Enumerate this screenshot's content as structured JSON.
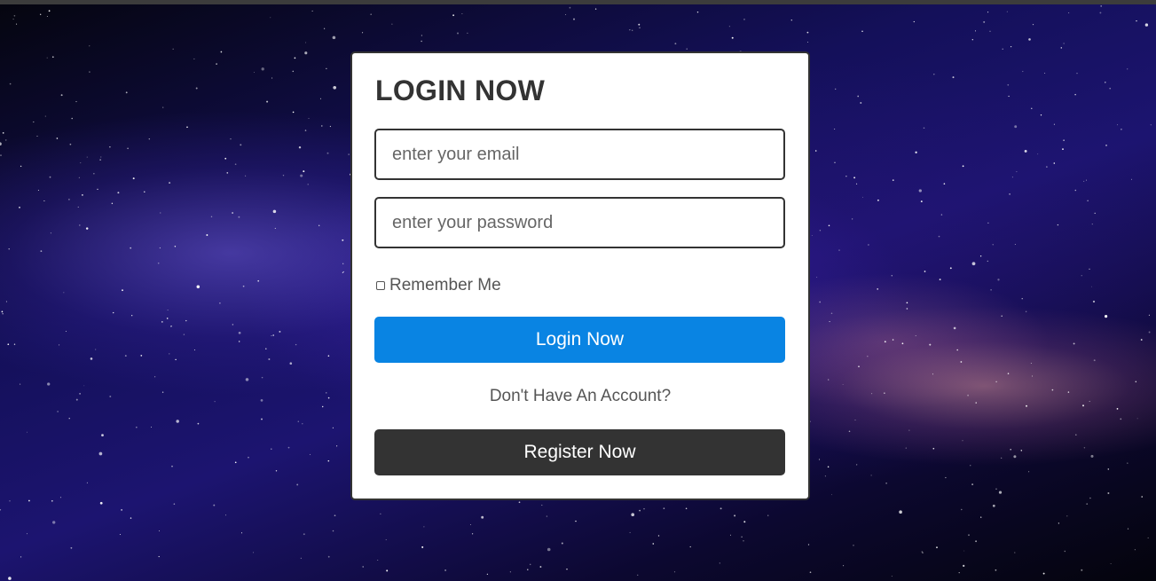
{
  "login_form": {
    "title": "LOGIN NOW",
    "email_placeholder": "enter your email",
    "password_placeholder": "enter your password",
    "remember_label": "Remember Me",
    "login_button": "Login Now",
    "no_account_text": "Don't Have An Account?",
    "register_button": "Register Now"
  },
  "colors": {
    "primary_button": "#0984e3",
    "secondary_button": "#333333",
    "text": "#333333"
  }
}
